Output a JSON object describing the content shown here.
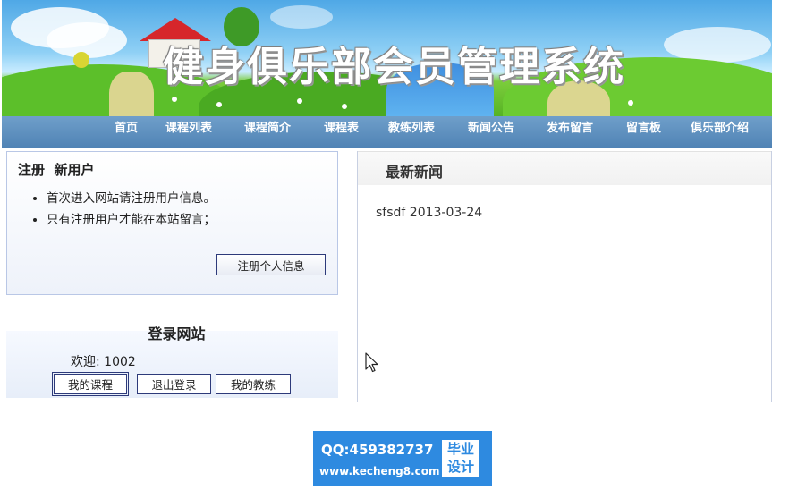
{
  "header": {
    "site_title": "健身俱乐部会员管理系统"
  },
  "nav": {
    "items": [
      {
        "label": "首页"
      },
      {
        "label": "课程列表"
      },
      {
        "label": "课程简介"
      },
      {
        "label": "课程表"
      },
      {
        "label": "教练列表"
      },
      {
        "label": "新闻公告"
      },
      {
        "label": "发布留言"
      },
      {
        "label": "留言板"
      },
      {
        "label": "俱乐部介绍"
      }
    ]
  },
  "register": {
    "title": "注册  新用户",
    "tips": [
      "首次进入网站请注册用户信息。",
      "只有注册用户才能在本站留言；"
    ],
    "button_label": "注册个人信息"
  },
  "login": {
    "title": "登录网站",
    "welcome": "欢迎: 1002",
    "buttons": {
      "my_courses": "我的课程",
      "logout": "退出登录",
      "my_coach": "我的教练"
    }
  },
  "news": {
    "title": "最新新闻",
    "items": [
      {
        "text": "sfsdf 2013-03-24"
      }
    ]
  },
  "watermark": {
    "qq": "QQ:459382737",
    "site": "www.kecheng8.com",
    "badge_line1": "毕业",
    "badge_line2": "设计"
  }
}
